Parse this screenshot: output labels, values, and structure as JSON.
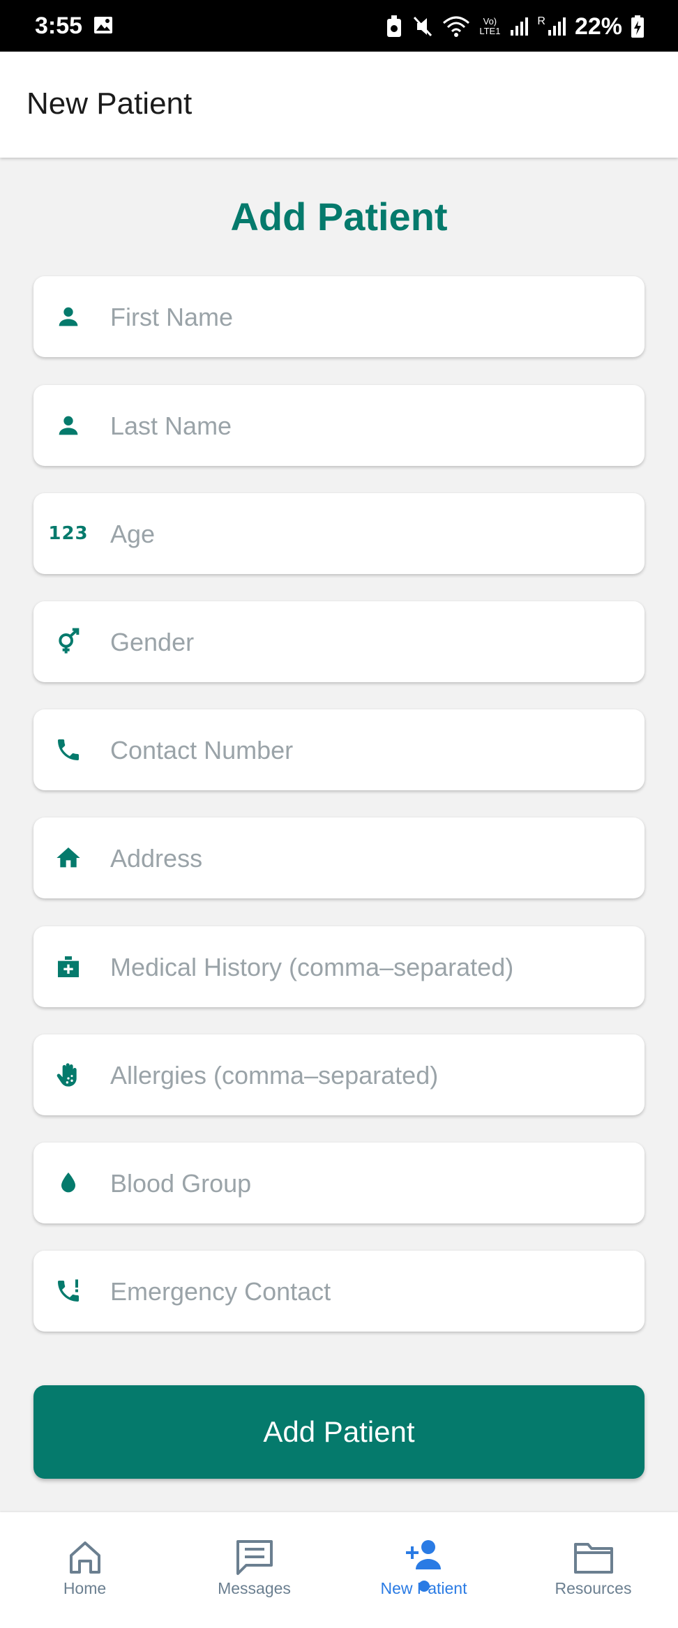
{
  "status_bar": {
    "time": "3:55",
    "battery": "22%",
    "icons": [
      "gallery-icon",
      "alarm-icon",
      "mute-icon",
      "wifi-icon",
      "volte-icon",
      "signal-icon",
      "signal-roaming-icon",
      "battery-charging-icon"
    ],
    "volte_text": "Vo) LTE1",
    "roaming_text": "R"
  },
  "app_bar": {
    "title": "New Patient"
  },
  "form": {
    "heading": "Add Patient",
    "fields": [
      {
        "placeholder": "First Name",
        "icon": "person-icon",
        "value": ""
      },
      {
        "placeholder": "Last Name",
        "icon": "person-icon",
        "value": ""
      },
      {
        "placeholder": "Age",
        "icon": "numbers-icon",
        "icon_text": "123",
        "value": ""
      },
      {
        "placeholder": "Gender",
        "icon": "gender-icon",
        "value": ""
      },
      {
        "placeholder": "Contact Number",
        "icon": "phone-icon",
        "value": ""
      },
      {
        "placeholder": "Address",
        "icon": "home-icon",
        "value": ""
      },
      {
        "placeholder": "Medical History (comma–separated)",
        "icon": "medical-bag-icon",
        "value": ""
      },
      {
        "placeholder": "Allergies (comma–separated)",
        "icon": "allergy-hand-icon",
        "value": ""
      },
      {
        "placeholder": "Blood Group",
        "icon": "blood-drop-icon",
        "value": ""
      },
      {
        "placeholder": "Emergency Contact",
        "icon": "emergency-phone-icon",
        "value": ""
      }
    ],
    "submit_label": "Add Patient"
  },
  "bottom_nav": {
    "tabs": [
      {
        "label": "Home",
        "icon": "home-outline-icon",
        "active": false
      },
      {
        "label": "Messages",
        "icon": "message-icon",
        "active": false
      },
      {
        "label": "New Patient",
        "icon": "person-add-icon",
        "active": true
      },
      {
        "label": "Resources",
        "icon": "folder-icon",
        "active": false
      }
    ]
  },
  "colors": {
    "primary": "#057a6c",
    "placeholder": "#9aa3a8",
    "nav_active": "#2a7be4",
    "nav_inactive": "#6b7f90",
    "background": "#f2f2f2"
  }
}
